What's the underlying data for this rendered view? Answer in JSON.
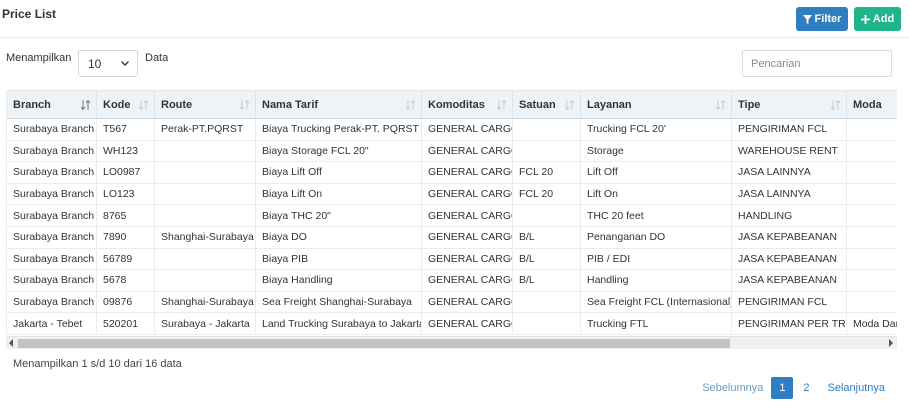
{
  "header": {
    "title": "Price List",
    "filter_label": "Filter",
    "add_label": "Add"
  },
  "controls": {
    "length_label": "Menampilkan",
    "length_value": "10",
    "data_label": "Data",
    "search_placeholder": "Pencarian"
  },
  "table": {
    "columns": [
      "Branch",
      "Kode",
      "Route",
      "Nama Tarif",
      "Komoditas",
      "Satuan",
      "Layanan",
      "Tipe",
      "Moda"
    ],
    "rows": [
      [
        "Surabaya Branch",
        "T567",
        "Perak-PT.PQRST",
        "Biaya Trucking Perak-PT. PQRST",
        "GENERAL CARGO",
        "",
        "Trucking FCL 20'",
        "PENGIRIMAN FCL",
        ""
      ],
      [
        "Surabaya Branch",
        "WH123",
        "",
        "Biaya Storage FCL 20\"",
        "GENERAL CARGO",
        "",
        "Storage",
        "WAREHOUSE RENT",
        ""
      ],
      [
        "Surabaya Branch",
        "LO0987",
        "",
        "Biaya Lift Off",
        "GENERAL CARGO",
        "FCL 20",
        "Lift Off",
        "JASA LAINNYA",
        ""
      ],
      [
        "Surabaya Branch",
        "LO123",
        "",
        "Biaya Lift On",
        "GENERAL CARGO",
        "FCL 20",
        "Lift On",
        "JASA LAINNYA",
        ""
      ],
      [
        "Surabaya Branch",
        "8765",
        "",
        "Biaya THC 20\"",
        "GENERAL CARGO",
        "",
        "THC 20 feet",
        "HANDLING",
        ""
      ],
      [
        "Surabaya Branch",
        "7890",
        "Shanghai-Surabaya",
        "Biaya DO",
        "GENERAL CARGO",
        "B/L",
        "Penanganan DO",
        "JASA KEPABEANAN",
        ""
      ],
      [
        "Surabaya Branch",
        "56789",
        "",
        "Biaya PIB",
        "GENERAL CARGO",
        "B/L",
        "PIB / EDI",
        "JASA KEPABEANAN",
        ""
      ],
      [
        "Surabaya Branch",
        "5678",
        "",
        "Biaya Handling",
        "GENERAL CARGO",
        "B/L",
        "Handling",
        "JASA KEPABEANAN",
        ""
      ],
      [
        "Surabaya Branch",
        "09876",
        "Shanghai-Surabaya",
        "Sea Freight Shanghai-Surabaya",
        "GENERAL CARGO",
        "",
        "Sea Freight FCL (Internasional)",
        "PENGIRIMAN FCL",
        ""
      ],
      [
        "Jakarta - Tebet",
        "520201",
        "Surabaya - Jakarta",
        "Land Trucking Surabaya to Jakarta",
        "GENERAL CARGO",
        "",
        "Trucking FTL",
        "PENGIRIMAN PER TRIP",
        "Moda Darat"
      ]
    ]
  },
  "footer": {
    "info": "Menampilkan 1 s/d 10 dari 16 data",
    "prev_label": "Sebelumnya",
    "pages": [
      "1",
      "2"
    ],
    "next_label": "Selanjutnya"
  },
  "colors": {
    "filter_button": "#2f7ec2",
    "add_button": "#1fb489",
    "header_bg": "#eef3f8"
  }
}
